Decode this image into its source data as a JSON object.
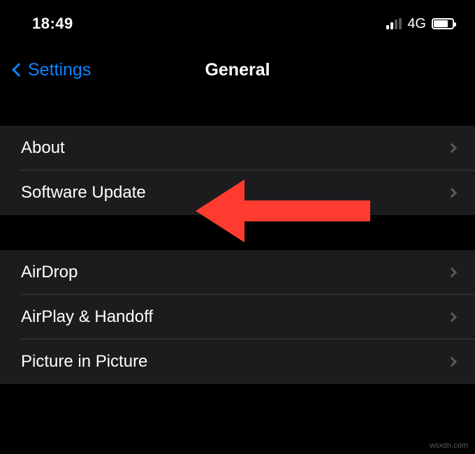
{
  "status_bar": {
    "time": "18:49",
    "network_label": "4G"
  },
  "nav": {
    "back_label": "Settings",
    "title": "General"
  },
  "groups": [
    {
      "items": [
        {
          "label": "About"
        },
        {
          "label": "Software Update"
        }
      ]
    },
    {
      "items": [
        {
          "label": "AirDrop"
        },
        {
          "label": "AirPlay & Handoff"
        },
        {
          "label": "Picture in Picture"
        }
      ]
    }
  ],
  "annotation": {
    "arrow_color": "#ff3b30"
  },
  "watermark": "wsxdn.com"
}
